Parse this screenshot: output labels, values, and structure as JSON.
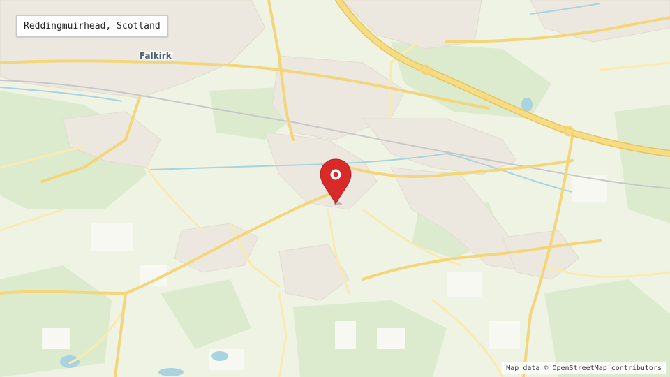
{
  "location_label": "Reddingmuirhead, Scotland",
  "map": {
    "place_labels": [
      "Falkirk"
    ],
    "attribution": "Map data © OpenStreetMap contributors",
    "marker_icon": "map-pin-icon",
    "colors": {
      "land": "#eef3e4",
      "urban": "#ede8df",
      "forest": "#dcebce",
      "field": "#f7f8f1",
      "water": "#a9d3df",
      "major_road": "#f6dc84",
      "minor_road": "#fbeab0",
      "marker": "#d92a2a"
    }
  }
}
